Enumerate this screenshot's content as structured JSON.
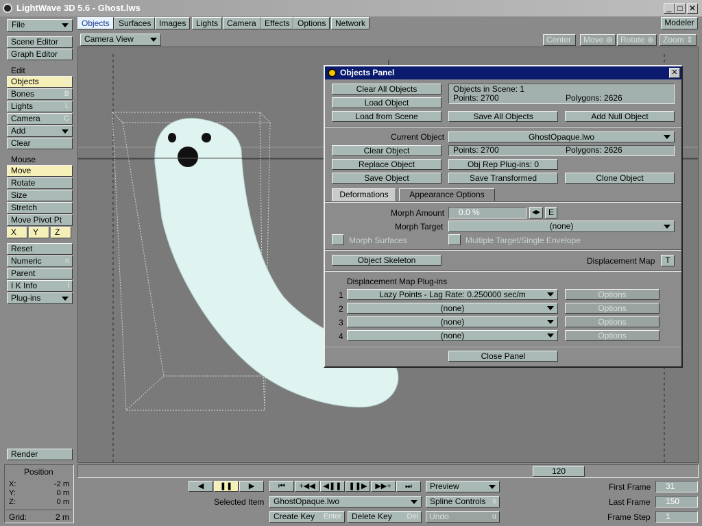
{
  "app": {
    "title": "LightWave 3D 5.6 - Ghost.lws",
    "modeler_label": "Modeler"
  },
  "titlebar": {
    "min_glyph": "_",
    "max_glyph": "□",
    "close_glyph": "✕"
  },
  "file_menu": "File",
  "tabs": [
    "Objects",
    "Surfaces",
    "Images",
    "Lights",
    "Camera",
    "Effects",
    "Options",
    "Network"
  ],
  "view_select": "Camera View",
  "viewport_tools": {
    "center": "Center",
    "move": "Move",
    "rotate": "Rotate",
    "zoom": "Zoom"
  },
  "sidebar": {
    "scene_editor": "Scene Editor",
    "graph_editor": "Graph Editor",
    "edit_header": "Edit",
    "edit_items": [
      {
        "label": "Objects",
        "key": "O"
      },
      {
        "label": "Bones",
        "key": "B"
      },
      {
        "label": "Lights",
        "key": "L"
      },
      {
        "label": "Camera",
        "key": "C"
      }
    ],
    "add": "Add",
    "clear": "Clear",
    "mouse_header": "Mouse",
    "mouse_items": [
      {
        "label": "Move",
        "key": ""
      },
      {
        "label": "Rotate",
        "key": ""
      },
      {
        "label": "Size",
        "key": ""
      },
      {
        "label": "Stretch",
        "key": ""
      },
      {
        "label": "Move Pivot Pt",
        "key": ""
      }
    ],
    "axes": [
      "X",
      "Y",
      "Z"
    ],
    "reset": "Reset",
    "lower_items": [
      {
        "label": "Numeric",
        "key": "n"
      },
      {
        "label": "Parent",
        "key": ""
      },
      {
        "label": "I K Info",
        "key": "i"
      }
    ],
    "plugins": "Plug-ins",
    "render": "Render"
  },
  "position": {
    "title": "Position",
    "x_label": "X:",
    "x_value": "-2 m",
    "y_label": "Y:",
    "y_value": "0 m",
    "z_label": "Z:",
    "z_value": "0 m",
    "grid_label": "Grid:",
    "grid_value": "2 m"
  },
  "timeline": {
    "current_frame": "120"
  },
  "transport": [
    "◀",
    "❚❚",
    "▶"
  ],
  "key_nav": [
    "⏮",
    "+◀◀",
    "◀❚❚",
    "❚❚▶",
    "▶▶+",
    "⏭"
  ],
  "preview": "Preview",
  "selected_item": {
    "label": "Selected Item",
    "value": "GhostOpaque.lwo"
  },
  "spline_controls": {
    "label": "Spline Controls",
    "key": "s"
  },
  "create_key": {
    "label": "Create Key",
    "key": "Enter"
  },
  "delete_key": {
    "label": "Delete Key",
    "key": "Del"
  },
  "undo": {
    "label": "Undo",
    "key": "u"
  },
  "frames": {
    "first_label": "First Frame",
    "first_value": "31",
    "last_label": "Last Frame",
    "last_value": "150",
    "step_label": "Frame Step",
    "step_value": "1"
  },
  "panel": {
    "title": "Objects Panel",
    "close_glyph": "✕",
    "clear_all": "Clear All Objects",
    "load_object": "Load Object",
    "load_from_scene": "Load from Scene",
    "objects_in_scene": "Objects in Scene: 1",
    "points_all": "Points: 2700",
    "polygons_all": "Polygons: 2626",
    "save_all": "Save All Objects",
    "add_null": "Add Null Object",
    "current_object_label": "Current Object",
    "current_object": "GhostOpaque.lwo",
    "clear_object": "Clear Object",
    "points_cur": "Points: 2700",
    "polygons_cur": "Polygons: 2626",
    "replace_object": "Replace Object",
    "obj_rep": "Obj Rep Plug-ins: 0",
    "save_object": "Save Object",
    "save_transformed": "Save Transformed",
    "clone_object": "Clone Object",
    "tab_deformations": "Deformations",
    "tab_appearance": "Appearance Options",
    "morph_amount_label": "Morph Amount",
    "morph_amount": "0.0 %",
    "env_arrows": "◀▶",
    "env_e": "E",
    "morph_target_label": "Morph Target",
    "morph_target": "(none)",
    "morph_surfaces": "Morph Surfaces",
    "multiple_target": "Multiple Target/Single Envelope",
    "object_skeleton": "Object Skeleton",
    "displacement_map": "Displacement Map",
    "disp_t": "T",
    "disp_plugins_header": "Displacement Map Plug-ins",
    "plugins": [
      {
        "n": "1",
        "value": "Lazy Points - Lag Rate: 0.250000 sec/m",
        "options": "Options"
      },
      {
        "n": "2",
        "value": "(none)",
        "options": "Options"
      },
      {
        "n": "3",
        "value": "(none)",
        "options": "Options"
      },
      {
        "n": "4",
        "value": "(none)",
        "options": "Options"
      }
    ],
    "close_panel": "Close Panel"
  }
}
